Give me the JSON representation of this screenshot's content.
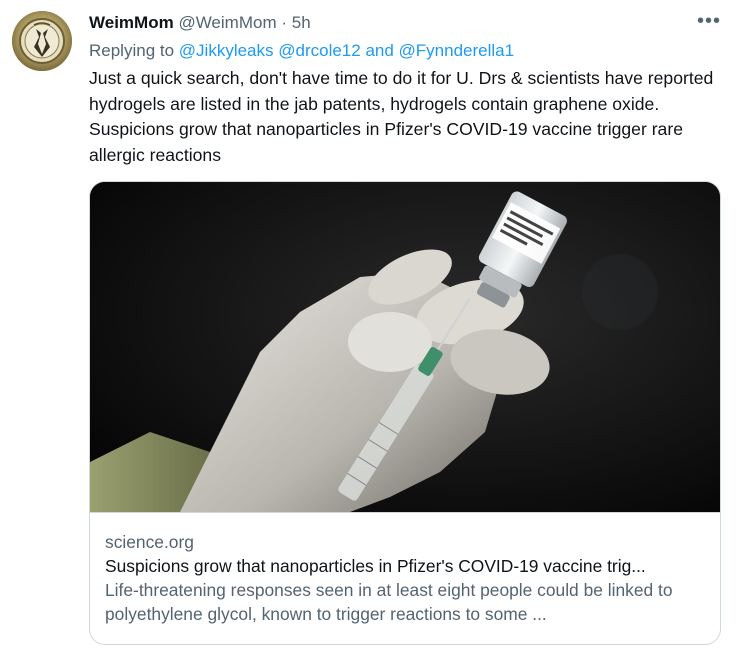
{
  "tweet": {
    "display_name": "WeimMom",
    "handle": "@WeimMom",
    "separator": "·",
    "time": "5h",
    "more_label": "•••",
    "replying_prefix": "Replying to ",
    "reply_handle_1": "@Jikkyleaks",
    "reply_handle_2": "@drcole12",
    "reply_joiner": " and ",
    "reply_handle_3": "@Fynnderella1",
    "text": "Just a quick search, don't have time to do it for U. Drs & scientists have reported hydrogels are listed in the jab patents, hydrogels contain graphene oxide.  Suspicions grow that nanoparticles in Pfizer's COVID-19 vaccine trigger rare allergic reactions"
  },
  "card": {
    "domain": "science.org",
    "title": "Suspicions grow that nanoparticles in Pfizer's COVID-19 vaccine trig...",
    "description": "Life-threatening responses seen in at least eight people could be linked to polyethylene glycol, known to trigger reactions to some ..."
  },
  "colors": {
    "accent": "#1d9bf0",
    "secondary_text": "#536471",
    "primary_text": "#0f1419",
    "border": "#cfd9de"
  }
}
